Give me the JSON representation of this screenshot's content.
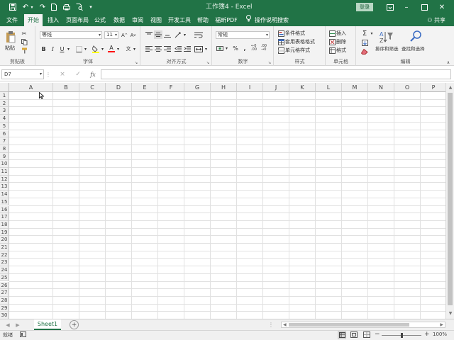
{
  "titlebar": {
    "doc_title": "工作簿4 - Excel",
    "login": "登录",
    "qa_icons": [
      "save-icon",
      "undo-icon",
      "redo-icon",
      "new-icon",
      "print-icon",
      "preview-icon",
      "customize-icon"
    ]
  },
  "tabs": [
    "文件",
    "开始",
    "插入",
    "页面布局",
    "公式",
    "数据",
    "审阅",
    "视图",
    "开发工具",
    "帮助",
    "福昕PDF",
    "操作说明搜索"
  ],
  "user": "共享",
  "ribbon": {
    "clipboard": {
      "paste": "粘贴",
      "label": "剪贴板"
    },
    "font": {
      "name": "等线",
      "size": "11",
      "label": "字体",
      "bold": "B",
      "italic": "I",
      "underline": "U",
      "fontcolor": "A"
    },
    "alignment": {
      "label": "对齐方式"
    },
    "number": {
      "format": "常规",
      "label": "数字",
      "percent": "%",
      "comma": ","
    },
    "styles": {
      "items": [
        "条件格式",
        "套用表格格式",
        "单元格样式"
      ],
      "label": "样式"
    },
    "cells": {
      "items": [
        "插入",
        "删除",
        "格式"
      ],
      "label": "单元格"
    },
    "editing": {
      "sortfilter": "排序和筛选",
      "findselect": "查找和选择",
      "label": "编辑"
    }
  },
  "formula_bar": {
    "namebox": "D7",
    "fx": "fx",
    "cancel": "×",
    "enter": "✓"
  },
  "columns": [
    "A",
    "B",
    "C",
    "D",
    "E",
    "F",
    "G",
    "H",
    "I",
    "J",
    "K",
    "L",
    "M",
    "N",
    "O",
    "P"
  ],
  "rows": [
    "1",
    "2",
    "3",
    "4",
    "5",
    "6",
    "7",
    "8",
    "9",
    "10",
    "11",
    "12",
    "13",
    "14",
    "15",
    "16",
    "17",
    "18",
    "19",
    "20",
    "21",
    "22",
    "23",
    "24",
    "25",
    "26",
    "27",
    "28",
    "29",
    "30"
  ],
  "sheet": {
    "tab": "Sheet1",
    "add": "+"
  },
  "status": {
    "ready": "就绪",
    "zoom": "100%"
  }
}
